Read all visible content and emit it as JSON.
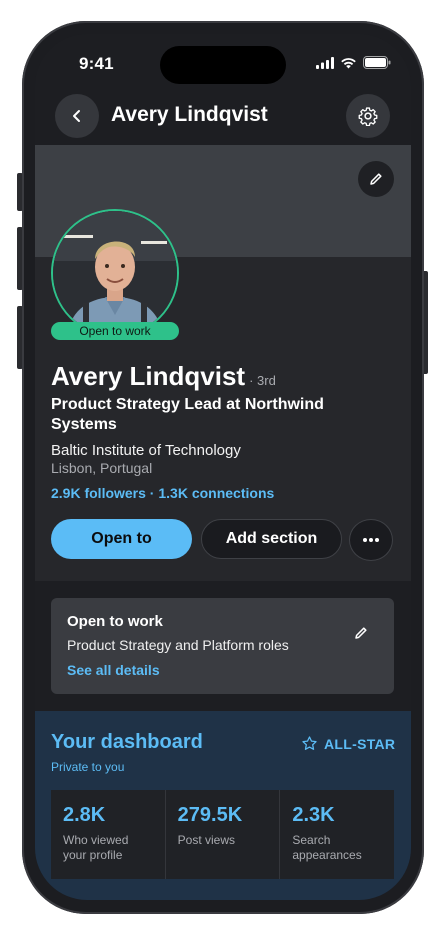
{
  "status_bar": {
    "time": "9:41"
  },
  "nav": {
    "title": "Avery Lindqvist"
  },
  "profile": {
    "open_to_work_badge": "Open to work",
    "name": "Avery Lindqvist",
    "degree": "· 3rd",
    "headline": "Product Strategy Lead at Northwind Systems",
    "school": "Baltic Institute of Technology",
    "location": "Lisbon, Portugal",
    "network": "2.9K followers · 1.3K connections"
  },
  "actions": {
    "open_to": "Open to",
    "add_section": "Add section"
  },
  "open_to_work": {
    "title": "Open to work",
    "roles": "Product Strategy and Platform roles",
    "link": "See all details"
  },
  "dashboard": {
    "title": "Your dashboard",
    "subtitle": "Private to you",
    "badge": "ALL-STAR",
    "stats": [
      {
        "value": "2.8K",
        "label": "Who viewed your profile"
      },
      {
        "value": "279.5K",
        "label": "Post views"
      },
      {
        "value": "2.3K",
        "label": "Search appearances"
      }
    ]
  },
  "colors": {
    "accent": "#5bbcf6",
    "open_to_work_green": "#2ec18a",
    "background": "#1d1e22",
    "dashboard_bg": "#1f3247"
  },
  "icons": [
    "back-arrow-icon",
    "gear-icon",
    "pencil-icon",
    "more-dots-icon",
    "star-icon",
    "signal-icon",
    "wifi-icon",
    "battery-icon"
  ]
}
